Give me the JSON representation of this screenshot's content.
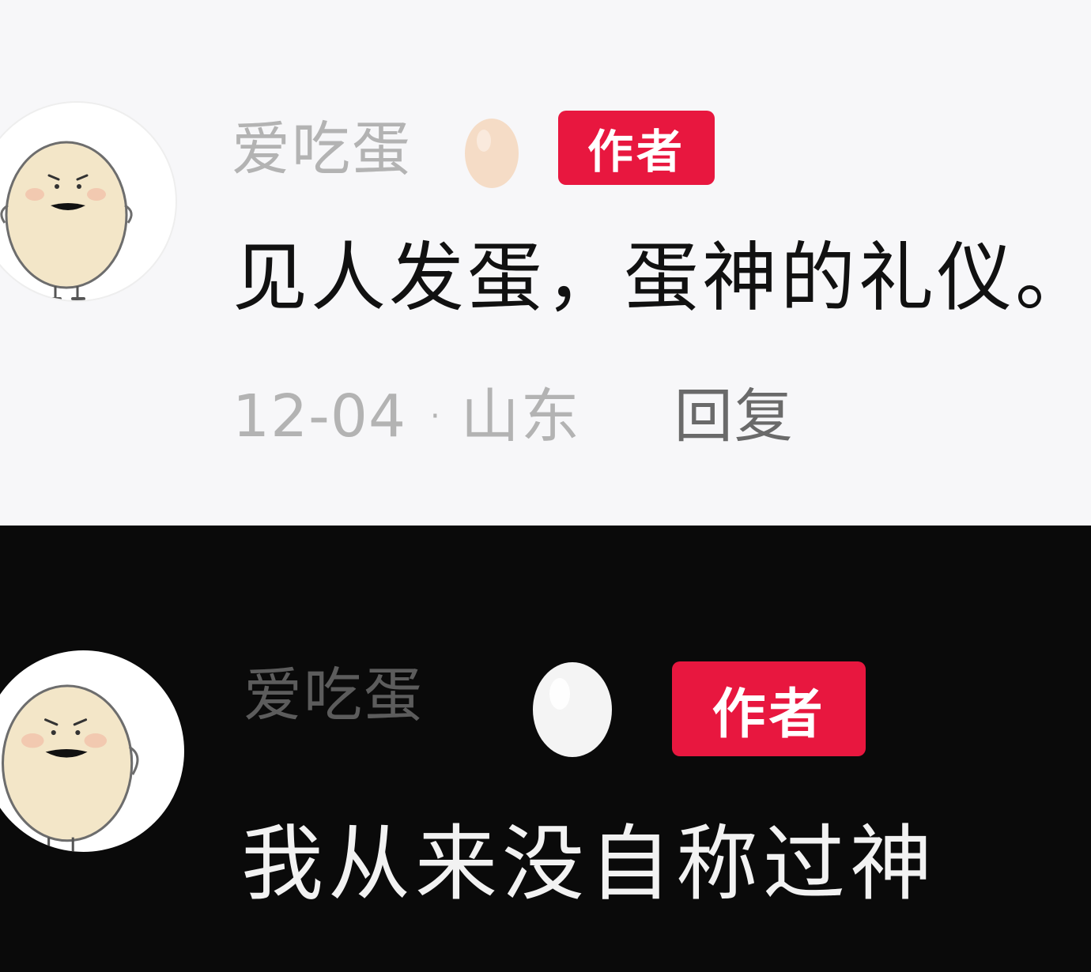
{
  "comments": [
    {
      "username": "爱吃蛋",
      "badge": "作者",
      "text": "见人发蛋，蛋神的礼仪。",
      "date": "12-04",
      "separator": "·",
      "location": "山东",
      "reply_label": "回复",
      "theme": "light",
      "egg_color": "#f5dcc6"
    },
    {
      "username": "爱吃蛋",
      "badge": "作者",
      "text": "我从来没自称过神",
      "theme": "dark",
      "egg_color": "#f4f4f4"
    }
  ],
  "colors": {
    "badge": "#e8173f",
    "light_background": "#f7f7f9",
    "dark_background": "#0a0a0a"
  }
}
